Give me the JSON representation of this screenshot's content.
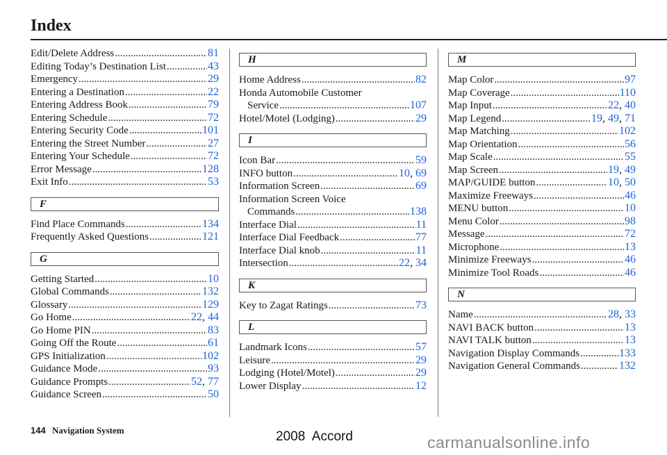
{
  "page": {
    "title": "Index",
    "footer_page_number": "144",
    "footer_section": "Navigation System",
    "model_label": "2008  Accord",
    "watermark": "carmanualsonline.info"
  },
  "colors": {
    "page_link": "#1f5fd6",
    "text": "#1a1a1a",
    "watermark": "#8a8a8a"
  },
  "columns": [
    {
      "blocks": [
        {
          "type": "entries",
          "entries": [
            {
              "label": "Edit/Delete Address",
              "pages": [
                "81"
              ]
            },
            {
              "label": "Editing Today’s Destination List",
              "pages": [
                "43"
              ]
            },
            {
              "label": "Emergency",
              "pages": [
                "29"
              ]
            },
            {
              "label": "Entering a Destination",
              "pages": [
                "22"
              ]
            },
            {
              "label": "Entering Address Book",
              "pages": [
                "79"
              ]
            },
            {
              "label": "Entering Schedule",
              "pages": [
                "72"
              ]
            },
            {
              "label": "Entering Security Code",
              "pages": [
                "101"
              ]
            },
            {
              "label": "Entering the Street Number",
              "pages": [
                "27"
              ]
            },
            {
              "label": "Entering Your Schedule",
              "pages": [
                "72"
              ]
            },
            {
              "label": "Error Message",
              "pages": [
                "128"
              ]
            },
            {
              "label": "Exit Info",
              "pages": [
                "53"
              ]
            }
          ]
        },
        {
          "type": "section",
          "letter": "F"
        },
        {
          "type": "entries",
          "entries": [
            {
              "label": "Find Place Commands",
              "pages": [
                "134"
              ]
            },
            {
              "label": "Frequently Asked Questions",
              "pages": [
                "121"
              ]
            }
          ]
        },
        {
          "type": "section",
          "letter": "G"
        },
        {
          "type": "entries",
          "entries": [
            {
              "label": "Getting Started",
              "pages": [
                "10"
              ]
            },
            {
              "label": "Global Commands",
              "pages": [
                "132"
              ]
            },
            {
              "label": "Glossary",
              "pages": [
                "129"
              ]
            },
            {
              "label": "Go Home",
              "pages": [
                "22",
                "44"
              ]
            },
            {
              "label": "Go Home PIN",
              "pages": [
                "83"
              ]
            },
            {
              "label": "Going Off the Route",
              "pages": [
                "61"
              ]
            },
            {
              "label": "GPS Initialization",
              "pages": [
                "102"
              ]
            },
            {
              "label": "Guidance Mode",
              "pages": [
                "93"
              ]
            },
            {
              "label": "Guidance Prompts",
              "pages": [
                "52",
                "77"
              ]
            },
            {
              "label": "Guidance Screen",
              "pages": [
                "50"
              ]
            }
          ]
        }
      ]
    },
    {
      "blocks": [
        {
          "type": "section",
          "letter": "H"
        },
        {
          "type": "entries",
          "entries": [
            {
              "label": "Home Address",
              "pages": [
                "82"
              ]
            },
            {
              "label": "Honda Automobile Customer",
              "continuation": "Service",
              "pages": [
                "107"
              ]
            },
            {
              "label": "Hotel/Motel (Lodging)",
              "pages": [
                "29"
              ]
            }
          ]
        },
        {
          "type": "section",
          "letter": "I"
        },
        {
          "type": "entries",
          "entries": [
            {
              "label": "Icon Bar",
              "pages": [
                "59"
              ]
            },
            {
              "label": "INFO button",
              "pages": [
                "10",
                "69"
              ]
            },
            {
              "label": "Information Screen",
              "pages": [
                "69"
              ]
            },
            {
              "label": "Information Screen Voice",
              "continuation": "Commands",
              "pages": [
                "138"
              ]
            },
            {
              "label": "Interface Dial",
              "pages": [
                "11"
              ]
            },
            {
              "label": "Interface Dial Feedback",
              "pages": [
                "77"
              ]
            },
            {
              "label": "Interface Dial knob",
              "pages": [
                "11"
              ]
            },
            {
              "label": "Intersection",
              "pages": [
                "22",
                "34"
              ]
            }
          ]
        },
        {
          "type": "section",
          "letter": "K"
        },
        {
          "type": "entries",
          "entries": [
            {
              "label": "Key to Zagat Ratings",
              "pages": [
                "73"
              ]
            }
          ]
        },
        {
          "type": "section",
          "letter": "L"
        },
        {
          "type": "entries",
          "entries": [
            {
              "label": "Landmark Icons",
              "pages": [
                "57"
              ]
            },
            {
              "label": "Leisure",
              "pages": [
                "29"
              ]
            },
            {
              "label": "Lodging (Hotel/Motel)",
              "pages": [
                "29"
              ]
            },
            {
              "label": "Lower Display",
              "pages": [
                "12"
              ]
            }
          ]
        }
      ]
    },
    {
      "blocks": [
        {
          "type": "section",
          "letter": "M"
        },
        {
          "type": "entries",
          "entries": [
            {
              "label": "Map Color",
              "pages": [
                "97"
              ]
            },
            {
              "label": "Map Coverage",
              "pages": [
                "110"
              ]
            },
            {
              "label": "Map Input",
              "pages": [
                "22",
                "40"
              ]
            },
            {
              "label": "Map Legend",
              "pages": [
                "19",
                "49",
                "71"
              ]
            },
            {
              "label": "Map Matching",
              "pages": [
                "102"
              ]
            },
            {
              "label": "Map Orientation",
              "pages": [
                "56"
              ]
            },
            {
              "label": "Map Scale",
              "pages": [
                "55"
              ]
            },
            {
              "label": "Map Screen",
              "pages": [
                "19",
                "49"
              ]
            },
            {
              "label": "MAP/GUIDE button",
              "pages": [
                "10",
                "50"
              ]
            },
            {
              "label": "Maximize Freeways",
              "pages": [
                "46"
              ]
            },
            {
              "label": "MENU button",
              "pages": [
                "10"
              ]
            },
            {
              "label": "Menu Color",
              "pages": [
                "98"
              ]
            },
            {
              "label": "Message",
              "pages": [
                "72"
              ]
            },
            {
              "label": "Microphone",
              "pages": [
                "13"
              ]
            },
            {
              "label": "Minimize Freeways",
              "pages": [
                "46"
              ]
            },
            {
              "label": "Minimize Tool Roads",
              "pages": [
                "46"
              ]
            }
          ]
        },
        {
          "type": "section",
          "letter": "N"
        },
        {
          "type": "entries",
          "entries": [
            {
              "label": "Name",
              "pages": [
                "28",
                "33"
              ]
            },
            {
              "label": "NAVI BACK button",
              "pages": [
                "13"
              ]
            },
            {
              "label": "NAVI TALK button",
              "pages": [
                "13"
              ]
            },
            {
              "label": "Navigation Display Commands",
              "pages": [
                "133"
              ]
            },
            {
              "label": "Navigation General Commands",
              "pages": [
                "132"
              ]
            }
          ]
        }
      ]
    }
  ]
}
